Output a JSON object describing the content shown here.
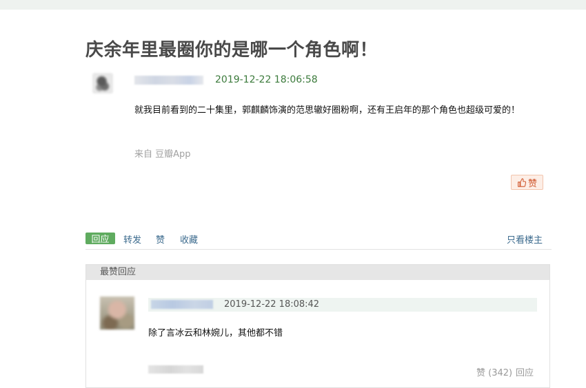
{
  "topic": {
    "title": "庆余年里最圈你的是哪一个角色啊！",
    "time": "2019-12-22 18:06:58",
    "content": "就我目前看到的二十集里，郭麒麟饰演的范思辙好圈粉啊，还有王启年的那个角色也超级可爱的！",
    "source": "来自 豆瓣App",
    "like_label": "赞"
  },
  "actions": {
    "reply": "回应",
    "forward": "转发",
    "like": "赞",
    "collect": "收藏",
    "only_author": "只看楼主"
  },
  "best_replies": {
    "header": "最赞回应",
    "items": [
      {
        "time": "2019-12-22 18:08:42",
        "content": "除了言冰云和林婉儿，其他都不错",
        "like_label": "赞 (342)",
        "reply_label": "回应"
      }
    ]
  },
  "colors": {
    "green_time": "#3b7a3b",
    "link": "#3b6a8d",
    "reply_button": "#5fab5f",
    "like_button": "#d0572d"
  },
  "icons": {
    "like": "thumbs-up-icon"
  }
}
